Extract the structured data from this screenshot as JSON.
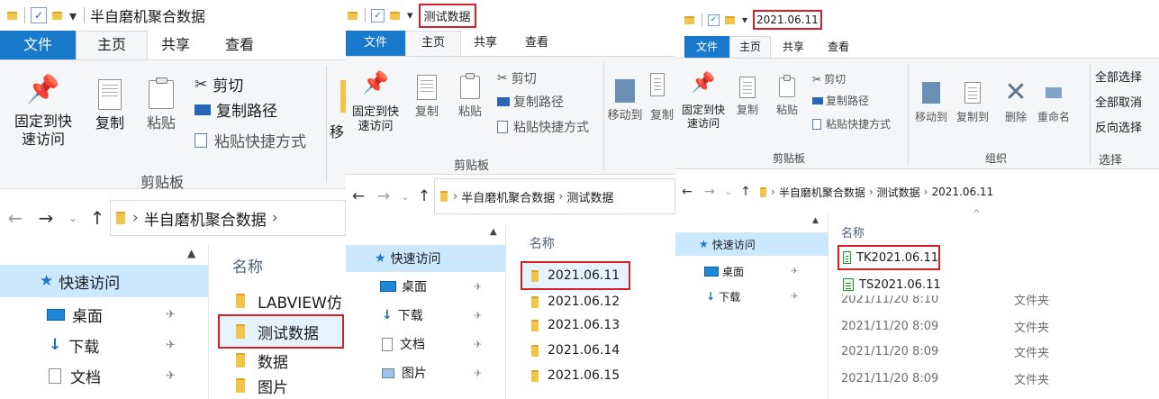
{
  "window1": {
    "title": "半自磨机聚合数据",
    "tabs": [
      "文件",
      "主页",
      "共享",
      "查看"
    ],
    "clipboard": {
      "pin_label_line1": "固定到快",
      "pin_label_line2": "速访问",
      "copy": "复制",
      "paste": "粘贴",
      "cut": "剪切",
      "copy_path": "复制路径",
      "paste_shortcut": "粘贴快捷方式",
      "group": "剪贴板"
    },
    "move_partial": "移",
    "breadcrumb": [
      "半自磨机聚合数据"
    ],
    "nav_quick_access": "快速访问",
    "nav_items": [
      "桌面",
      "下载",
      "文档"
    ],
    "column_name": "名称",
    "files": [
      "LABVIEW仿",
      "测试数据",
      "数据",
      "图片"
    ]
  },
  "window2": {
    "title": "测试数据",
    "tabs": [
      "文件",
      "主页",
      "共享",
      "查看"
    ],
    "clipboard": {
      "pin_label_line1": "固定到快",
      "pin_label_line2": "速访问",
      "copy": "复制",
      "paste": "粘贴",
      "cut": "剪切",
      "copy_path": "复制路径",
      "paste_shortcut": "粘贴快捷方式",
      "group": "剪贴板"
    },
    "organize": {
      "move_to": "移动到",
      "copy_to_partial": "复制"
    },
    "breadcrumb": [
      "半自磨机聚合数据",
      "测试数据"
    ],
    "nav_quick_access": "快速访问",
    "nav_items": [
      "桌面",
      "下载",
      "文档",
      "图片"
    ],
    "column_name": "名称",
    "files": [
      "2021.06.11",
      "2021.06.12",
      "2021.06.13",
      "2021.06.14",
      "2021.06.15"
    ]
  },
  "window3": {
    "title": "2021.06.11",
    "tabs": [
      "文件",
      "主页",
      "共享",
      "查看"
    ],
    "clipboard": {
      "pin_label_line1": "固定到快",
      "pin_label_line2": "速访问",
      "copy": "复制",
      "paste": "粘贴",
      "cut": "剪切",
      "copy_path": "复制路径",
      "paste_shortcut": "粘贴快捷方式",
      "group": "剪贴板"
    },
    "organize": {
      "move_to": "移动到",
      "copy_to": "复制到",
      "delete": "删除",
      "rename": "重命名",
      "group": "组织"
    },
    "select": {
      "select_all": "全部选择",
      "select_none": "全部取消",
      "invert": "反向选择",
      "group": "选择"
    },
    "breadcrumb": [
      "半自磨机聚合数据",
      "测试数据",
      "2021.06.11"
    ],
    "nav_quick_access": "快速访问",
    "nav_items": [
      "桌面",
      "下载"
    ],
    "column_name": "名称",
    "files": [
      "TK2021.06.11",
      "TS2021.06.11"
    ],
    "partial_row": "2021/11/20 8:10",
    "partial_type": "文件夹",
    "modified": [
      "2021/11/20 8:09",
      "2021/11/20 8:09",
      "2021/11/20 8:09"
    ],
    "types": [
      "文件夹",
      "文件夹",
      "文件夹"
    ]
  }
}
